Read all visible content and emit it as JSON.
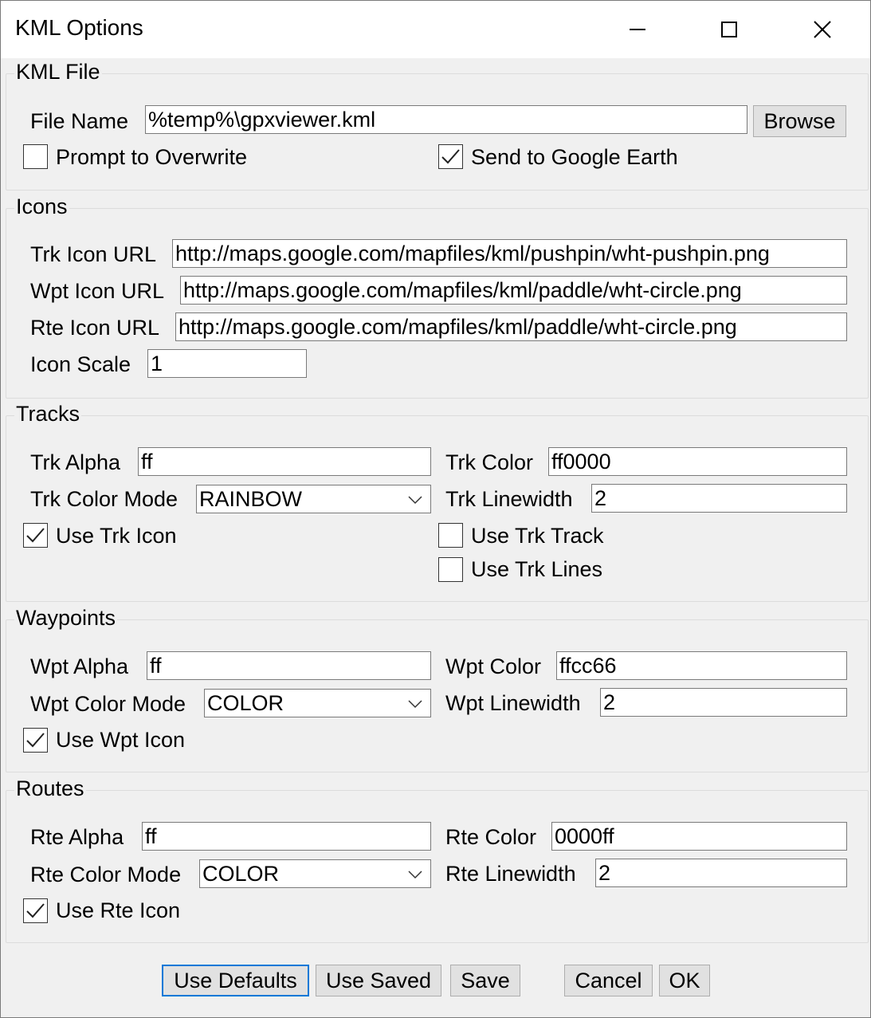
{
  "window": {
    "title": "KML Options"
  },
  "kml_file": {
    "legend": "KML File",
    "file_name_label": "File Name",
    "file_name_value": "%temp%\\gpxviewer.kml",
    "browse_label": "Browse",
    "prompt_overwrite_label": "Prompt to Overwrite",
    "prompt_overwrite_checked": false,
    "send_ge_label": "Send to Google Earth",
    "send_ge_checked": true
  },
  "icons": {
    "legend": "Icons",
    "trk_icon_label": "Trk Icon URL",
    "trk_icon_value": "http://maps.google.com/mapfiles/kml/pushpin/wht-pushpin.png",
    "wpt_icon_label": "Wpt Icon URL",
    "wpt_icon_value": "http://maps.google.com/mapfiles/kml/paddle/wht-circle.png",
    "rte_icon_label": "Rte Icon URL",
    "rte_icon_value": "http://maps.google.com/mapfiles/kml/paddle/wht-circle.png",
    "scale_label": "Icon Scale",
    "scale_value": "1"
  },
  "tracks": {
    "legend": "Tracks",
    "alpha_label": "Trk Alpha",
    "alpha_value": "ff",
    "color_label": "Trk Color",
    "color_value": "ff0000",
    "mode_label": "Trk Color Mode",
    "mode_value": "RAINBOW",
    "linewidth_label": "Trk Linewidth",
    "linewidth_value": "2",
    "use_icon_label": "Use Trk Icon",
    "use_icon_checked": true,
    "use_track_label": "Use Trk Track",
    "use_track_checked": false,
    "use_lines_label": "Use Trk Lines",
    "use_lines_checked": false
  },
  "waypoints": {
    "legend": "Waypoints",
    "alpha_label": "Wpt Alpha",
    "alpha_value": "ff",
    "color_label": "Wpt Color",
    "color_value": "ffcc66",
    "mode_label": "Wpt Color Mode",
    "mode_value": "COLOR",
    "linewidth_label": "Wpt Linewidth",
    "linewidth_value": "2",
    "use_icon_label": "Use Wpt Icon",
    "use_icon_checked": true
  },
  "routes": {
    "legend": "Routes",
    "alpha_label": "Rte Alpha",
    "alpha_value": "ff",
    "color_label": "Rte Color",
    "color_value": "0000ff",
    "mode_label": "Rte Color Mode",
    "mode_value": "COLOR",
    "linewidth_label": "Rte Linewidth",
    "linewidth_value": "2",
    "use_icon_label": "Use Rte Icon",
    "use_icon_checked": true
  },
  "buttons": {
    "use_defaults": "Use Defaults",
    "use_saved": "Use Saved",
    "save": "Save",
    "cancel": "Cancel",
    "ok": "OK"
  },
  "icons_meta": {
    "minimize": "minimize-icon",
    "maximize": "maximize-icon",
    "close": "close-icon",
    "check": "checkmark-icon",
    "dropdown": "chevron-down-icon"
  },
  "colors": {
    "accent": "#0078d7",
    "window_bg": "#f0f0f0",
    "titlebar_bg": "#ffffff"
  }
}
